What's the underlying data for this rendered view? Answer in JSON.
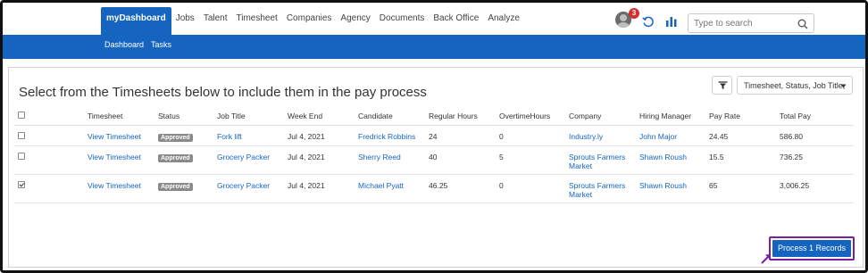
{
  "nav": {
    "items": [
      "myDashboard",
      "Jobs",
      "Talent",
      "Timesheet",
      "Companies",
      "Agency",
      "Documents",
      "Back Office",
      "Analyze"
    ],
    "active_index": 0
  },
  "notifications": {
    "count": "3"
  },
  "search": {
    "placeholder": "Type to search"
  },
  "subnav": {
    "items": [
      "Dashboard",
      "Tasks"
    ]
  },
  "page": {
    "heading": "Select from the Timesheets below to include them in the pay process",
    "columns_select_label": "Timesheet, Status, Job Title,"
  },
  "table": {
    "headers": [
      "Timesheet",
      "Status",
      "Job Title",
      "Week End",
      "Candidate",
      "Regular Hours",
      "OvertimeHours",
      "Company",
      "Hiring Manager",
      "Pay Rate",
      "Total Pay"
    ],
    "rows": [
      {
        "checked": false,
        "timesheet": "View Timesheet",
        "status": "Approved",
        "job_title": "Fork lift",
        "week_end": "Jul 4, 2021",
        "candidate": "Fredrick Robbins",
        "regular_hours": "24",
        "overtime_hours": "0",
        "company": "Industry.ly",
        "hiring_manager": "John Major",
        "pay_rate": "24.45",
        "total_pay": "586.80"
      },
      {
        "checked": false,
        "timesheet": "View Timesheet",
        "status": "Approved",
        "job_title": "Grocery Packer",
        "week_end": "Jul 4, 2021",
        "candidate": "Sherry Reed",
        "regular_hours": "40",
        "overtime_hours": "5",
        "company": "Sprouts Farmers Market",
        "hiring_manager": "Shawn Roush",
        "pay_rate": "15.5",
        "total_pay": "736.25"
      },
      {
        "checked": true,
        "timesheet": "View Timesheet",
        "status": "Approved",
        "job_title": "Grocery Packer",
        "week_end": "Jul 4, 2021",
        "candidate": "Michael Pyatt",
        "regular_hours": "46.25",
        "overtime_hours": "0",
        "company": "Sprouts Farmers Market",
        "hiring_manager": "Shawn Roush",
        "pay_rate": "65",
        "total_pay": "3,006.25"
      }
    ]
  },
  "actions": {
    "process_label": "Process 1 Records"
  },
  "colors": {
    "primary": "#1565c0",
    "highlight": "#7b1fa2",
    "badge": "#d32f2f",
    "status": "#8a8a8a"
  },
  "icons": {
    "refresh": "refresh-icon",
    "analytics": "bar-chart-icon",
    "search": "search-icon",
    "filter": "filter-icon",
    "caret": "caret-down-icon"
  }
}
